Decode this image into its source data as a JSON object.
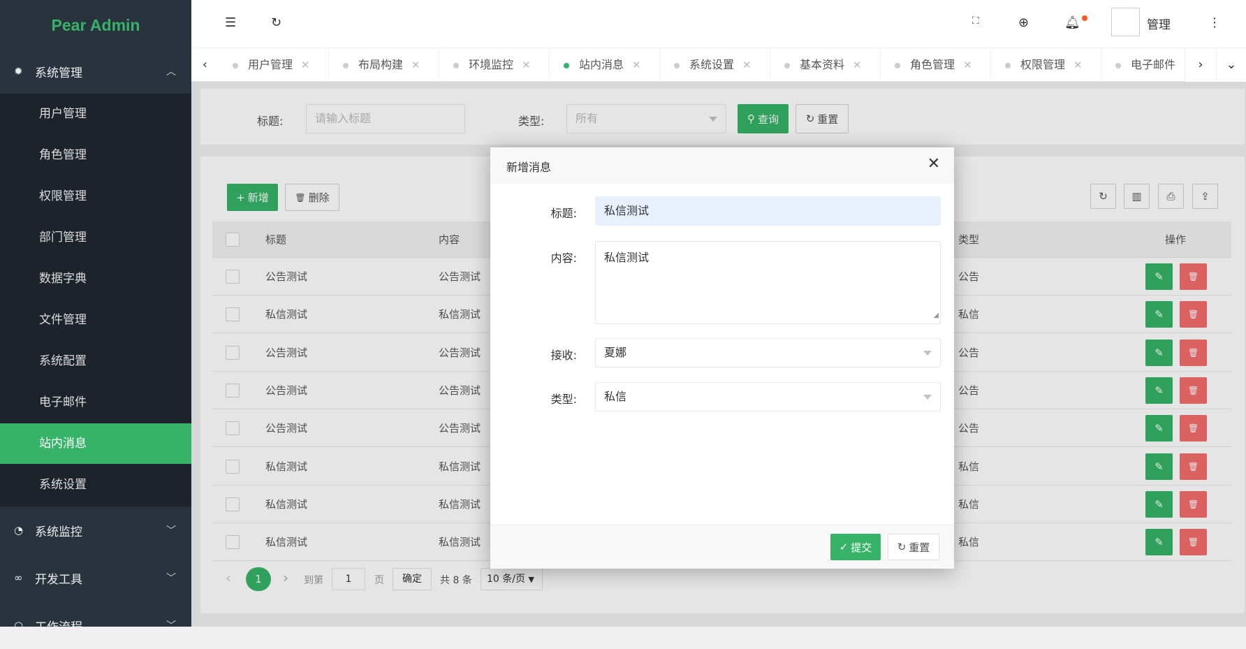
{
  "app": {
    "logo": "Pear Admin"
  },
  "sidebar": {
    "group_system": "系统管理",
    "items": [
      {
        "label": "用户管理"
      },
      {
        "label": "角色管理"
      },
      {
        "label": "权限管理"
      },
      {
        "label": "部门管理"
      },
      {
        "label": "数据字典"
      },
      {
        "label": "文件管理"
      },
      {
        "label": "系统配置"
      },
      {
        "label": "电子邮件"
      },
      {
        "label": "站内消息",
        "active": true
      },
      {
        "label": "系统设置"
      }
    ],
    "group_monitor": "系统监控",
    "group_dev": "开发工具",
    "group_flow": "工作流程"
  },
  "header": {
    "user_name": "管理",
    "notification_dot_color": "#ff5722"
  },
  "tabs": [
    {
      "label": "用户管理"
    },
    {
      "label": "布局构建"
    },
    {
      "label": "环境监控"
    },
    {
      "label": "站内消息",
      "active": true
    },
    {
      "label": "系统设置"
    },
    {
      "label": "基本资料"
    },
    {
      "label": "角色管理"
    },
    {
      "label": "权限管理"
    },
    {
      "label": "电子邮件"
    }
  ],
  "search": {
    "title_label": "标题:",
    "title_placeholder": "请输入标题",
    "type_label": "类型:",
    "type_value": "所有",
    "query_button": "查询",
    "reset_button": "重置"
  },
  "toolbar": {
    "add_button": "新增",
    "delete_button": "删除"
  },
  "table": {
    "columns": [
      "标题",
      "内容",
      "类型",
      "操作"
    ],
    "rows": [
      {
        "title": "公告测试",
        "content": "公告测试",
        "type": "公告"
      },
      {
        "title": "私信测试",
        "content": "私信测试",
        "type": "私信"
      },
      {
        "title": "公告测试",
        "content": "公告测试",
        "type": "公告"
      },
      {
        "title": "公告测试",
        "content": "公告测试",
        "type": "公告"
      },
      {
        "title": "公告测试",
        "content": "公告测试",
        "type": "公告"
      },
      {
        "title": "私信测试",
        "content": "私信测试",
        "type": "私信"
      },
      {
        "title": "私信测试",
        "content": "私信测试",
        "type": "私信"
      },
      {
        "title": "私信测试",
        "content": "私信测试",
        "type": "私信"
      }
    ]
  },
  "pagination": {
    "current": "1",
    "goto_label": "到第",
    "goto_value": "1",
    "page_label": "页",
    "confirm": "确定",
    "total": "共 8 条",
    "page_size": "10 条/页"
  },
  "modal": {
    "title": "新增消息",
    "title_label": "标题:",
    "title_value": "私信测试",
    "content_label": "内容:",
    "content_value": "私信测试",
    "receiver_label": "接收:",
    "receiver_value": "夏娜",
    "type_label": "类型:",
    "type_value": "私信",
    "submit": "提交",
    "reset": "重置"
  },
  "colors": {
    "accent": "#36b368",
    "danger": "#f56c6c",
    "sidebar_bg": "#28333e"
  }
}
